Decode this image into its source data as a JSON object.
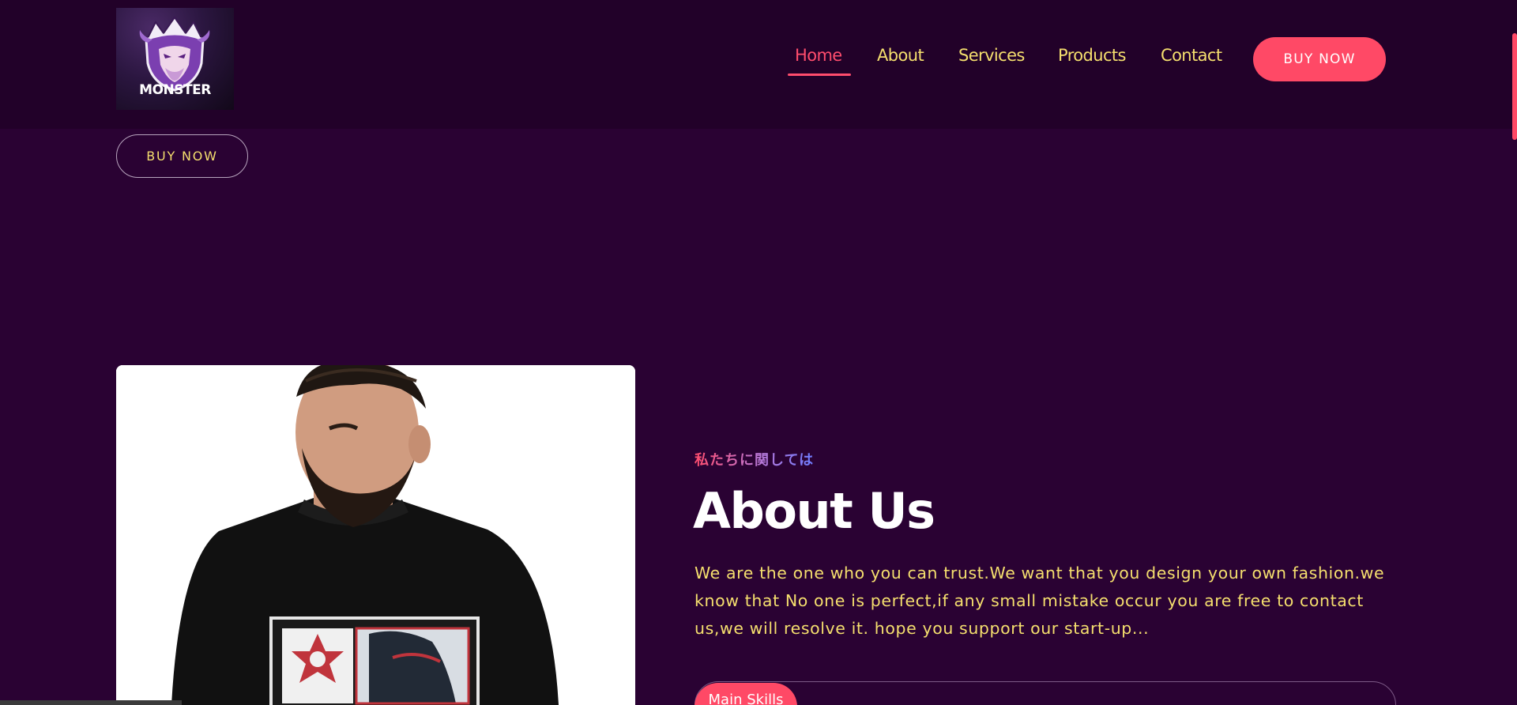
{
  "logo": {
    "text": "MONSTER",
    "icon": "monster-mascot-icon"
  },
  "nav": {
    "items": [
      {
        "label": "Home",
        "active": true
      },
      {
        "label": "About",
        "active": false
      },
      {
        "label": "Services",
        "active": false
      },
      {
        "label": "Products",
        "active": false
      },
      {
        "label": "Contact",
        "active": false
      }
    ],
    "cta_label": "BUY NOW"
  },
  "hero": {
    "button_label": "BUY NOW"
  },
  "about": {
    "tagline": "私たちに関しては",
    "title": "About Us",
    "description": "We are the one who you can trust.We want that you design your own fashion.we know that No one is perfect,if any small mistake occur you are free to contact us,we will resolve it. hope you support our start-up...",
    "skills_tab_label": "Main Skills",
    "image": "man-in-black-anime-tshirt-photo"
  },
  "colors": {
    "background": "#2a0233",
    "header": "#220129",
    "accent": "#ff4966",
    "nav_text": "#f5df6e",
    "body_text": "#f5df6e"
  }
}
